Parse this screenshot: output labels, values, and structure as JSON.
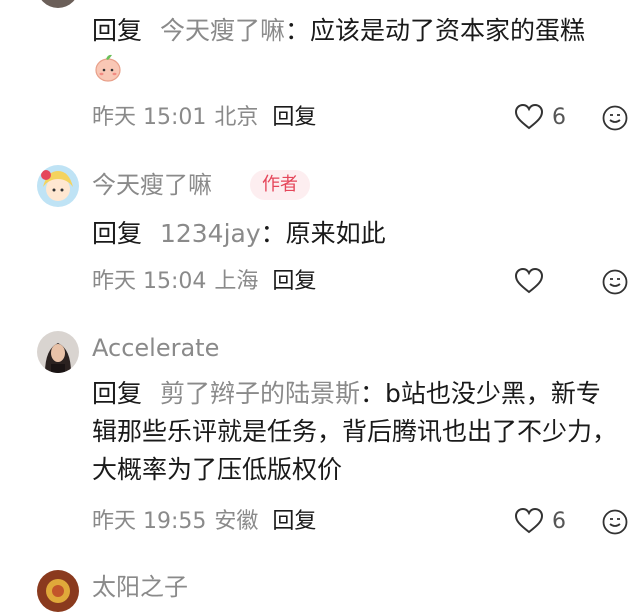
{
  "comments": [
    {
      "reply_label": "回复",
      "reply_to": "今天瘦了嘛",
      "text": "：应该是动了资本家的蛋糕",
      "time": "昨天 15:01",
      "location": "北京",
      "reply_action": "回复",
      "likes": "6"
    },
    {
      "author": "今天瘦了嘛",
      "badge": "作者",
      "reply_label": "回复",
      "reply_to": "1234jay",
      "text": "：原来如此",
      "time": "昨天 15:04",
      "location": "上海",
      "reply_action": "回复"
    },
    {
      "author": "Accelerate",
      "reply_label": "回复",
      "reply_to": "剪了辫子的陆景斯",
      "text": "：b站也没少黑，新专辑那些乐评就是任务，背后腾讯也出了不少力，大概率为了压低版权价",
      "time": "昨天 19:55",
      "location": "安徽",
      "reply_action": "回复",
      "likes": "6"
    },
    {
      "author": "太阳之子"
    }
  ],
  "colors": {
    "badge_bg": "#fdeef0",
    "badge_text": "#e5465a",
    "muted": "#8a8a8a"
  }
}
